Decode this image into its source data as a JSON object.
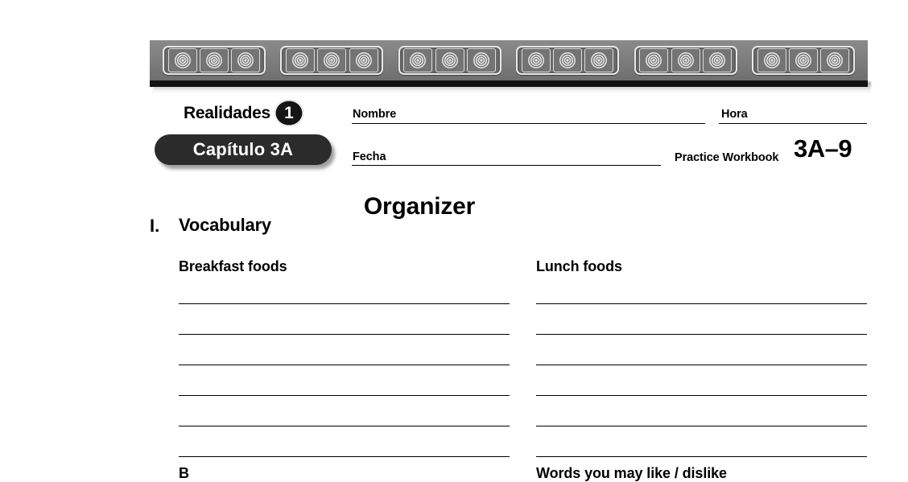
{
  "document": {
    "series_title": "Realidades",
    "level": "1",
    "chapter": "Capítulo 3A",
    "page_title": "Organizer",
    "workbook_label": "Practice Workbook",
    "workbook_code": "3A–9"
  },
  "fields": {
    "name_label": "Nombre",
    "hour_label": "Hora",
    "date_label": "Fecha"
  },
  "section": {
    "number": "I.",
    "title": "Vocabulary"
  },
  "columns": {
    "left": {
      "heading": "Breakfast foods",
      "line_count": 6,
      "next_heading_partial": "B"
    },
    "right": {
      "heading": "Lunch foods",
      "line_count": 6,
      "next_heading_partial": "Words you may like / dislike"
    }
  },
  "banner": {
    "cartouche_count": 6,
    "medallions_per_cartouche": 3,
    "body_color": "#7c7c7c",
    "base_color": "#141414",
    "motif_color": "#e8e8e8"
  },
  "colors": {
    "page_background": "#ffffff",
    "ink": "#000000",
    "pill_background": "#2b2b2b",
    "pill_text": "#ffffff"
  }
}
